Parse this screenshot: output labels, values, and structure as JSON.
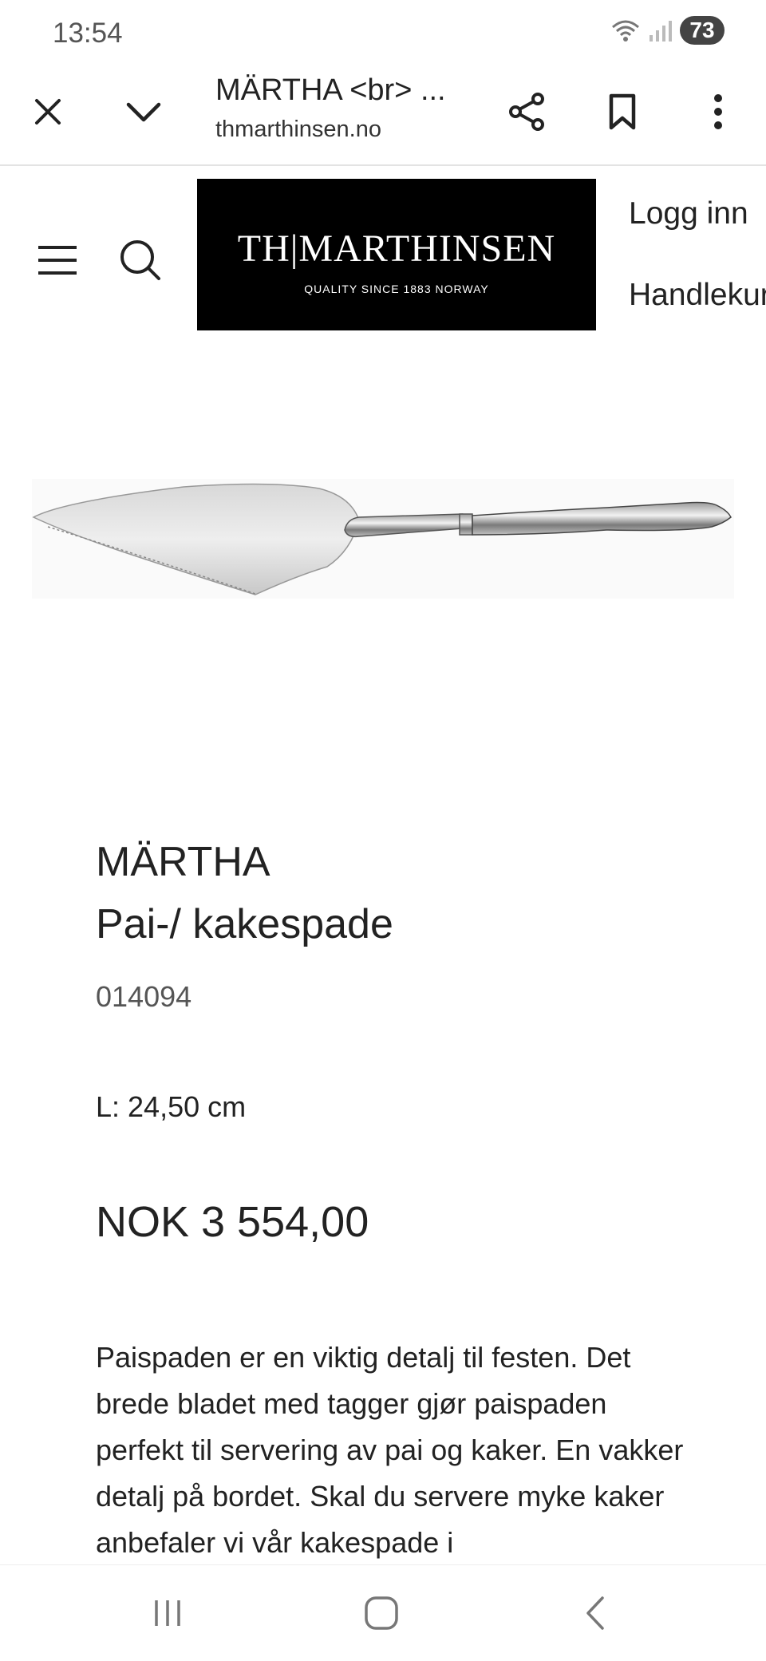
{
  "status_bar": {
    "time": "13:54",
    "battery": "73"
  },
  "browser": {
    "title": "MÄRTHA <br> ...",
    "url": "thmarthinsen.no"
  },
  "site": {
    "logo_name": "TH|MARTHINSEN",
    "logo_tagline": "QUALITY SINCE 1883  NORWAY",
    "login": "Logg inn",
    "cart": "Handlekurv"
  },
  "product": {
    "brand": "MÄRTHA",
    "name": "Pai-/ kakespade",
    "sku": "014094",
    "dimension": "L: 24,50 cm",
    "price": "NOK 3 554,00",
    "description": "Paispaden er en viktig detalj til festen. Det brede bladet med tagger gjør paispaden perfekt til servering av pai og kaker. En vakker detalj på bordet. Skal du servere myke kaker anbefaler vi vår kakespade i"
  }
}
